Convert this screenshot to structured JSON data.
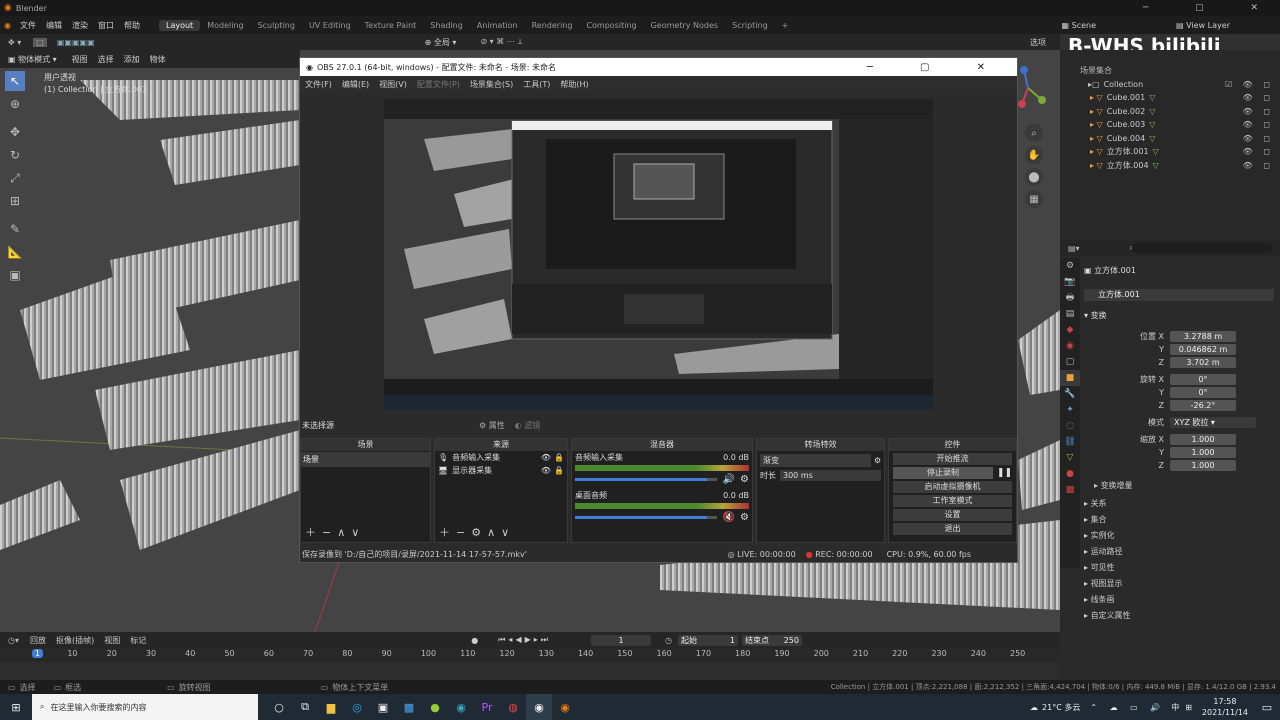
{
  "app": {
    "title": "Blender"
  },
  "menu": {
    "items": [
      "文件",
      "编辑",
      "渲染",
      "窗口",
      "帮助"
    ]
  },
  "workspaces": [
    "Layout",
    "Modeling",
    "Sculpting",
    "UV Editing",
    "Texture Paint",
    "Shading",
    "Animation",
    "Rendering",
    "Compositing",
    "Geometry Nodes",
    "Scripting"
  ],
  "scene": {
    "name": "Scene",
    "view_layer": "View Layer"
  },
  "header": {
    "mode": "物体模式",
    "items": [
      "视图",
      "选择",
      "添加",
      "物体"
    ],
    "global": "全局",
    "options": "选项"
  },
  "viewport": {
    "line1": "用户透视",
    "line2": "(1) Collection | 立方体.001"
  },
  "watermark": {
    "text": "B-WHS bilibili"
  },
  "outliner": {
    "root": "场景集合",
    "collection": "Collection",
    "items": [
      "Cube.001",
      "Cube.002",
      "Cube.003",
      "Cube.004",
      "立方体.001",
      "立方体.004"
    ]
  },
  "properties": {
    "object": "立方体.001",
    "object2": "立方体.001",
    "transform": "变换",
    "location_label": "位置 X",
    "loc": [
      "3.2788 m",
      "0.046862 m",
      "3.702 m"
    ],
    "rotation_label": "旋转 X",
    "rot": [
      "0°",
      "0°",
      "-26.2°"
    ],
    "mode_label": "模式",
    "mode": "XYZ 欧拉",
    "scale_label": "缩放 X",
    "scale": [
      "1.000",
      "1.000",
      "1.000"
    ],
    "axis_y": "Y",
    "axis_z": "Z",
    "delta": "变换增量",
    "sections": [
      "关系",
      "集合",
      "实例化",
      "运动路径",
      "可见性",
      "视图显示",
      "线条画",
      "自定义属性"
    ]
  },
  "obs": {
    "title": "OBS 27.0.1 (64-bit, windows) - 配置文件: 未命名 - 场景: 未命名",
    "menu": [
      "文件(F)",
      "编辑(E)",
      "视图(V)",
      "配置文件(P)",
      "场景集合(S)",
      "工具(T)",
      "帮助(H)"
    ],
    "no_source": "未选择源",
    "props_btn": "属性",
    "filter_btn": "滤镜",
    "panels": {
      "scenes": "场景",
      "sources": "来源",
      "mixer": "混音器",
      "transitions": "转场特效",
      "controls": "控件"
    },
    "scene_item": "场景",
    "sources": [
      "音频输入采集",
      "显示器采集"
    ],
    "mixer": [
      {
        "name": "音频输入采集",
        "db": "0.0 dB",
        "level": 0.93
      },
      {
        "name": "桌面音频",
        "db": "0.0 dB",
        "level": 0.93
      }
    ],
    "transition": "渐变",
    "duration_label": "时长",
    "duration": "300 ms",
    "controls": [
      "开始推流",
      "停止录制",
      "启动虚拟摄像机",
      "工作室模式",
      "设置",
      "退出"
    ],
    "status_file": "保存录像到 'D:/自己的项目/录屏/2021-11-14 17-57-57.mkv'",
    "live": "LIVE: 00:00:00",
    "rec": "REC: 00:00:00",
    "cpu": "CPU: 0.9%, 60.00 fps"
  },
  "timeline": {
    "header": [
      "回放",
      "抠像(插帧)",
      "视图",
      "标记"
    ],
    "current": "1",
    "start_label": "起始",
    "start": "1",
    "end_label": "结束点",
    "end": "250",
    "ticks": [
      "1",
      "10",
      "20",
      "30",
      "40",
      "50",
      "60",
      "70",
      "80",
      "90",
      "100",
      "110",
      "120",
      "130",
      "140",
      "150",
      "160",
      "170",
      "180",
      "190",
      "200",
      "210",
      "220",
      "230",
      "240",
      "250"
    ]
  },
  "statusbar": {
    "left": [
      "选择",
      "框选",
      "旋转视图",
      "物体上下文菜单"
    ],
    "right": "Collection | 立方体.001 | 顶点:2,221,088 | 面:2,212,352 | 三角面:4,424,704 | 物体:0/6 | 内存: 449.8 MiB | 显存: 1.4/12.0 GB | 2.93.4"
  },
  "taskbar": {
    "search": "在这里输入你要搜索的内容",
    "weather": "21°C 多云",
    "time": "17:58",
    "date": "2021/11/14",
    "ime": "中"
  }
}
